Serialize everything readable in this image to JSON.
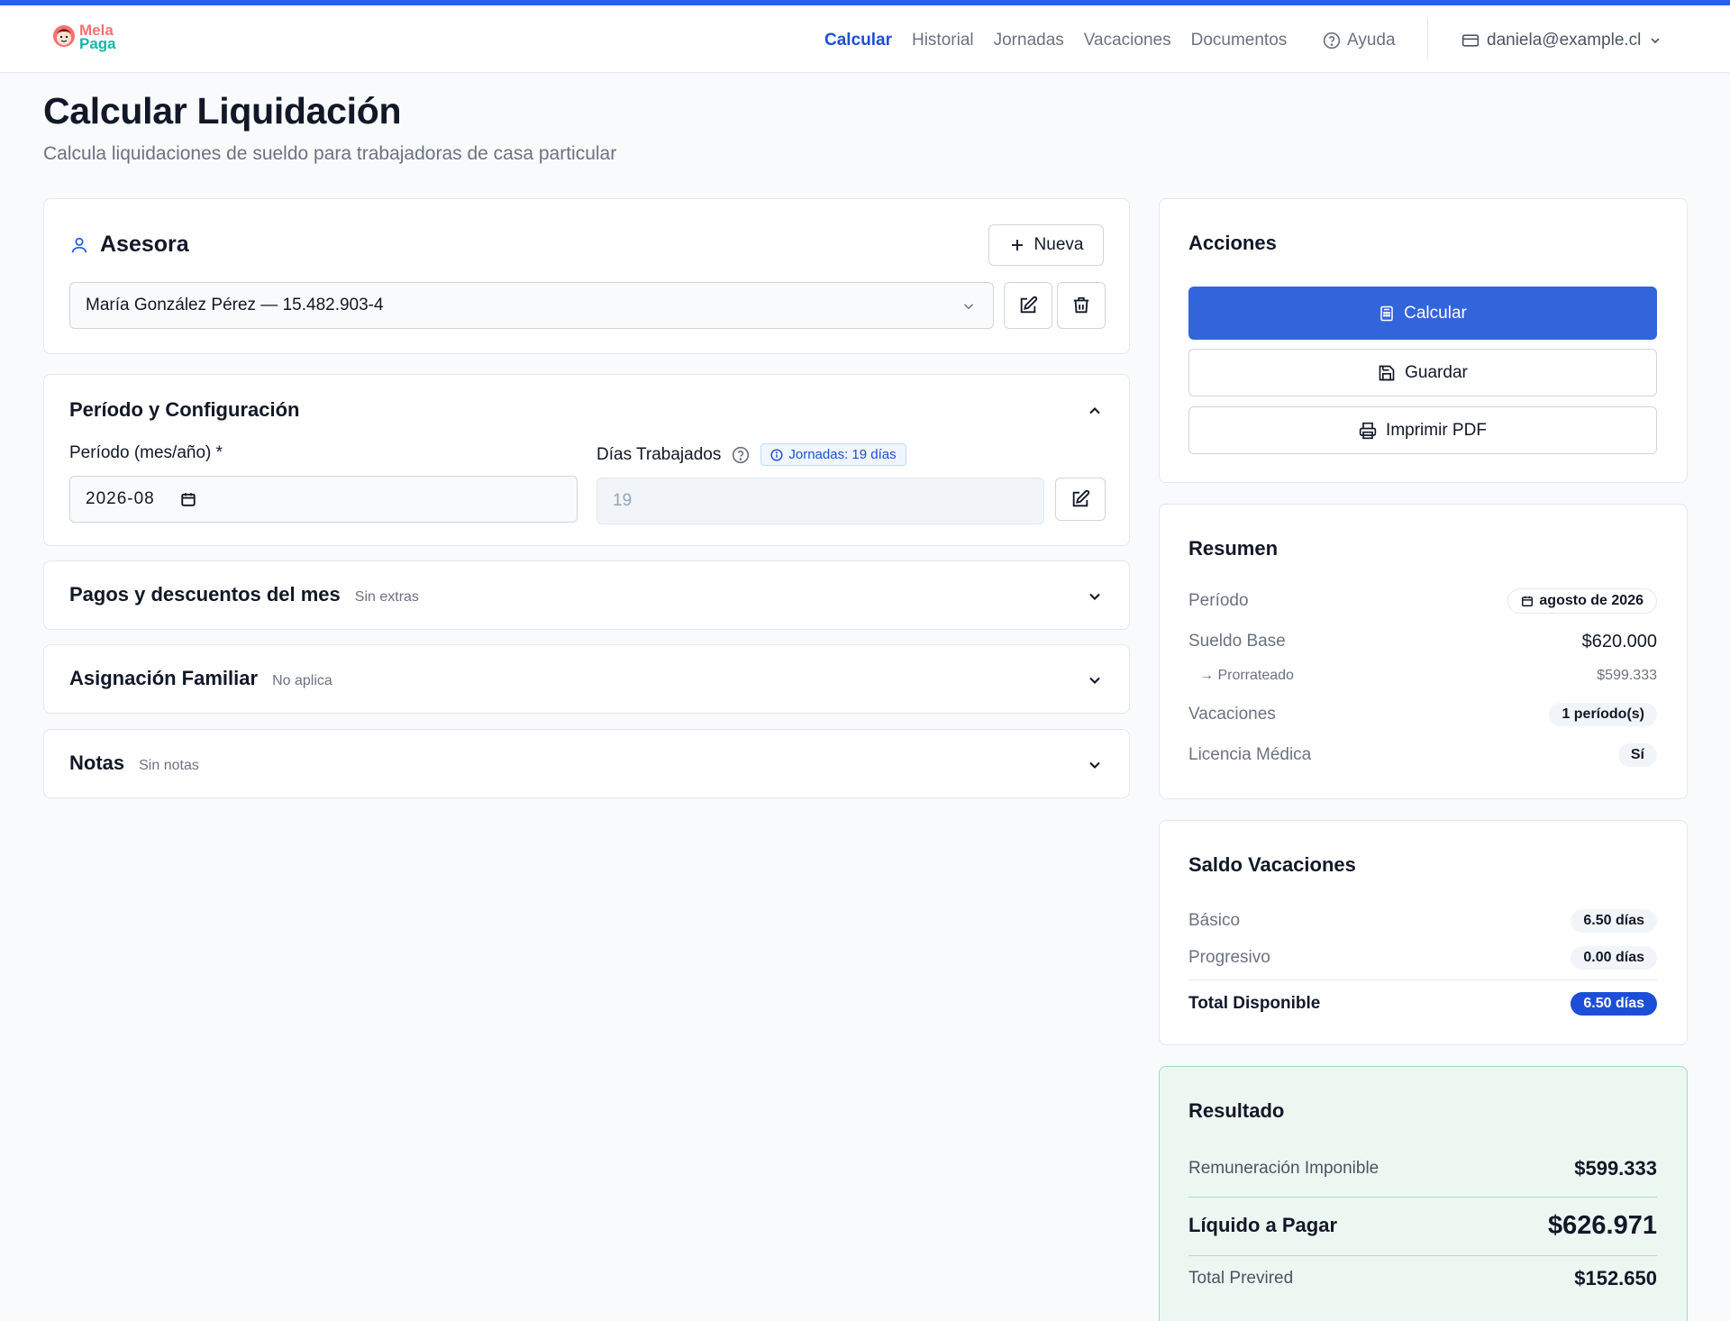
{
  "brand": {
    "line1": "Mela",
    "line2": "Paga"
  },
  "nav": {
    "links": [
      {
        "label": "Calcular"
      },
      {
        "label": "Historial"
      },
      {
        "label": "Jornadas"
      },
      {
        "label": "Vacaciones"
      },
      {
        "label": "Documentos"
      }
    ],
    "help": "Ayuda",
    "user_email": "daniela@example.cl"
  },
  "page": {
    "title": "Calcular Liquidación",
    "subtitle": "Calcula liquidaciones de sueldo para trabajadoras de casa particular"
  },
  "asesora": {
    "title": "Asesora",
    "new_label": "Nueva",
    "selected": "María González Pérez — 15.482.903-4"
  },
  "periodo": {
    "title": "Período y Configuración",
    "period_label": "Período (mes/año) *",
    "period_value": "2026-08",
    "days_label": "Días Trabajados",
    "jornadas_badge": "Jornadas: 19 días",
    "days_value": "19"
  },
  "sections": {
    "pagos": {
      "title": "Pagos y descuentos del mes",
      "note": "Sin extras"
    },
    "asignacion": {
      "title": "Asignación Familiar",
      "note": "No aplica"
    },
    "notas": {
      "title": "Notas",
      "note": "Sin notas"
    }
  },
  "acciones": {
    "title": "Acciones",
    "calcular": "Calcular",
    "guardar": "Guardar",
    "imprimir": "Imprimir PDF"
  },
  "resumen": {
    "title": "Resumen",
    "periodo_label": "Período",
    "periodo_value": "agosto de 2026",
    "sueldo_label": "Sueldo Base",
    "sueldo_value": "$620.000",
    "prorrateado_label": "→ Prorrateado",
    "prorrateado_value": "$599.333",
    "vacaciones_label": "Vacaciones",
    "vacaciones_value": "1 período(s)",
    "licencia_label": "Licencia Médica",
    "licencia_value": "Sí"
  },
  "saldo": {
    "title": "Saldo Vacaciones",
    "basico_label": "Básico",
    "basico_value": "6.50 días",
    "progresivo_label": "Progresivo",
    "progresivo_value": "0.00 días",
    "total_label": "Total Disponible",
    "total_value": "6.50 días"
  },
  "resultado": {
    "title": "Resultado",
    "imponible_label": "Remuneración Imponible",
    "imponible_value": "$599.333",
    "liquido_label": "Líquido a Pagar",
    "liquido_value": "$626.971",
    "previred_label": "Total Previred",
    "previred_value": "$152.650"
  },
  "colors": {
    "accent": "#2563eb",
    "primary_button": "#3264dc",
    "nav_active": "#1d4ed8",
    "result_bg": "#ecf7f1",
    "result_border": "#a7d9bf"
  }
}
